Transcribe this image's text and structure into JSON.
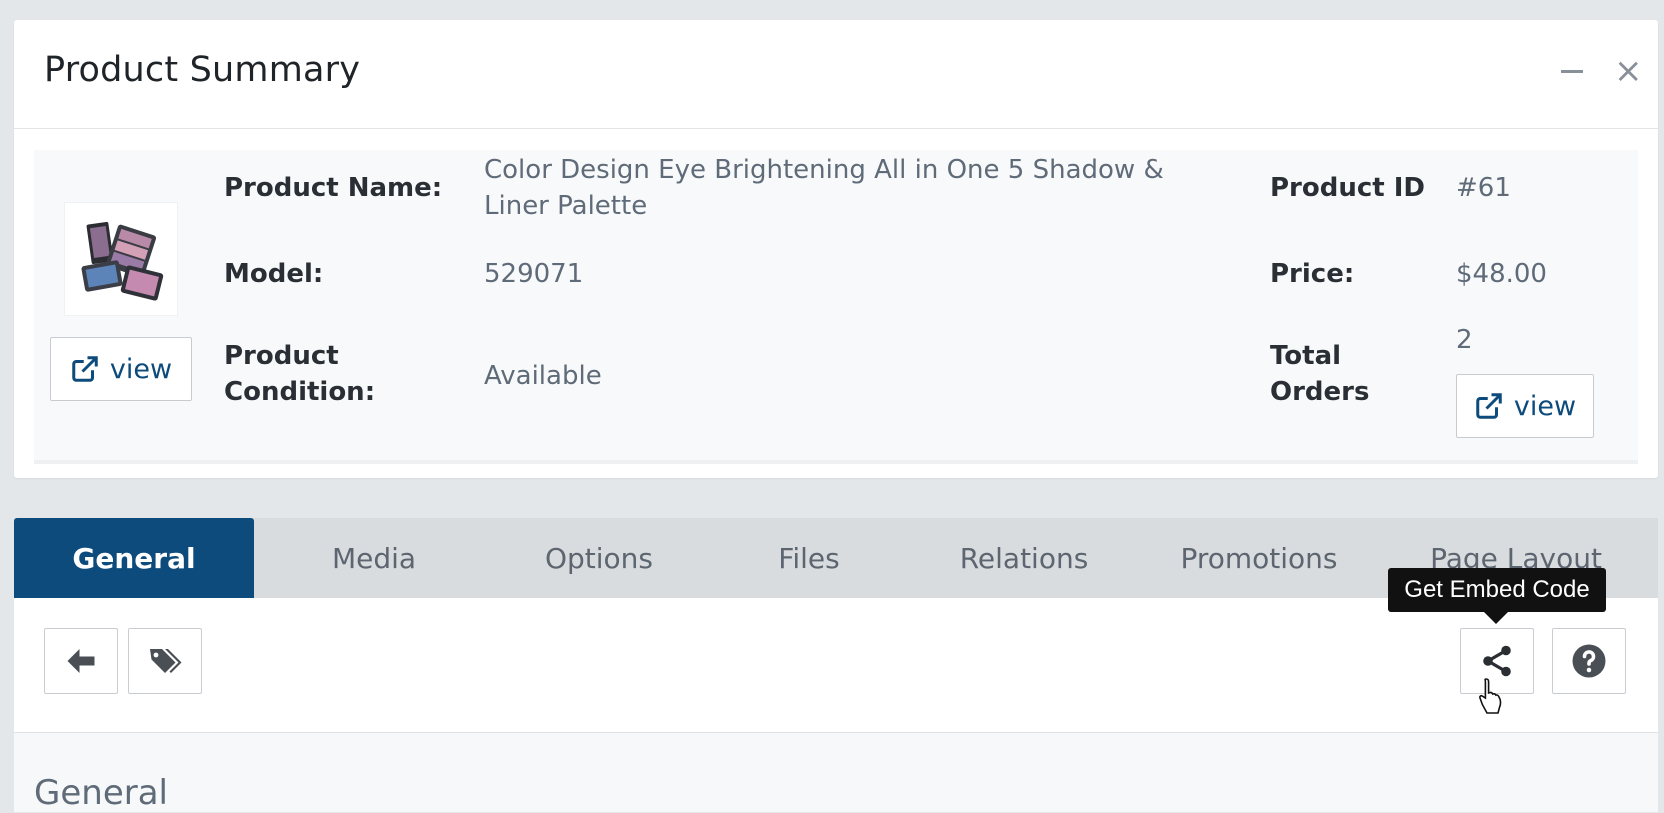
{
  "panel": {
    "title": "Product Summary"
  },
  "summary": {
    "view_label": "view",
    "product_name_label": "Product Name:",
    "product_name_value": "Color Design Eye Brightening All in One 5 Shadow & Liner Palette",
    "model_label": "Model:",
    "model_value": "529071",
    "condition_label": "Product Condition:",
    "condition_value": "Available",
    "product_id_label": "Product ID",
    "product_id_value": "#61",
    "price_label": "Price:",
    "price_value": "$48.00",
    "total_orders_label": "Total Orders",
    "total_orders_value": "2",
    "orders_view_label": "view"
  },
  "tabs": [
    {
      "label": "General",
      "active": true
    },
    {
      "label": "Media"
    },
    {
      "label": "Options"
    },
    {
      "label": "Files"
    },
    {
      "label": "Relations"
    },
    {
      "label": "Promotions"
    },
    {
      "label": "Page Layout"
    }
  ],
  "toolbar": {
    "tooltip": "Get Embed Code"
  },
  "section": {
    "title": "General"
  },
  "colors": {
    "accent": "#0d4b7c",
    "background": "#e4e7ea",
    "tab_bar": "#d9dcdf"
  }
}
